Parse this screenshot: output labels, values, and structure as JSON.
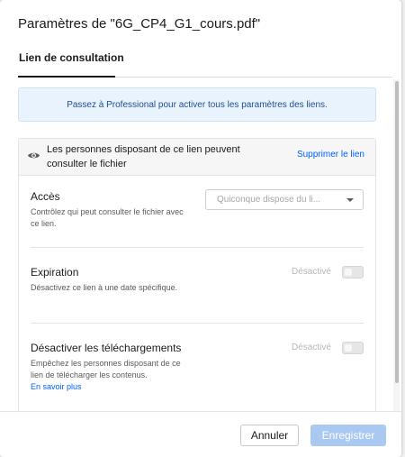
{
  "dialog": {
    "title": "Paramètres de \"6G_CP4_G1_cours.pdf\"",
    "tab_label": "Lien de consultation"
  },
  "banner": {
    "text": "Passez à Professional pour activer tous les paramètres des liens."
  },
  "link_panel": {
    "header_text": "Les personnes disposant de ce lien peuvent consulter le fichier",
    "remove_link": "Supprimer le lien",
    "access": {
      "title": "Accès",
      "description": "Contrôlez qui peut consulter le fichier avec ce lien.",
      "select_value": "Quiconque dispose du li..."
    },
    "expiration": {
      "title": "Expiration",
      "description": "Désactivez ce lien à une date spécifique.",
      "state_label": "Désactivé",
      "enabled": false
    },
    "downloads": {
      "title": "Désactiver les téléchargements",
      "description": "Empêchez les personnes disposant de ce lien de télécharger les contenus.",
      "learn_more": "En savoir plus",
      "state_label": "Désactivé",
      "enabled": false
    }
  },
  "footer": {
    "cancel_label": "Annuler",
    "save_label": "Enregistrer"
  },
  "colors": {
    "accent": "#0061fe",
    "banner_bg": "#e9f3fd",
    "save_disabled": "#a9c8f2"
  }
}
